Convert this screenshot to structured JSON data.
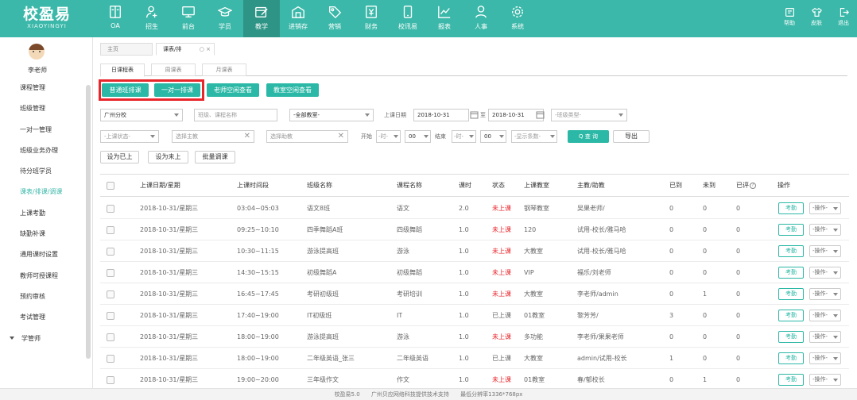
{
  "brand": {
    "name": "校盈易",
    "sub": "XIAOYINGYI"
  },
  "nav": [
    {
      "label": "OA",
      "icon": "oa-icon"
    },
    {
      "label": "招生",
      "icon": "enroll-icon"
    },
    {
      "label": "前台",
      "icon": "frontdesk-icon"
    },
    {
      "label": "学员",
      "icon": "student-icon"
    },
    {
      "label": "教学",
      "icon": "teaching-icon",
      "active": true
    },
    {
      "label": "进销存",
      "icon": "inventory-icon"
    },
    {
      "label": "营销",
      "icon": "marketing-icon"
    },
    {
      "label": "财务",
      "icon": "finance-icon"
    },
    {
      "label": "校讯易",
      "icon": "mobile-icon"
    },
    {
      "label": "报表",
      "icon": "report-icon"
    },
    {
      "label": "人事",
      "icon": "hr-icon"
    },
    {
      "label": "系统",
      "icon": "system-icon"
    }
  ],
  "tools": [
    {
      "label": "帮助",
      "icon": "help-icon"
    },
    {
      "label": "皮肤",
      "icon": "skin-icon"
    },
    {
      "label": "退出",
      "icon": "logout-icon"
    }
  ],
  "user": {
    "name": "李老师"
  },
  "sidebar": {
    "items": [
      "课程管理",
      "班级管理",
      "一对一管理",
      "班级业务办理",
      "待分班学员",
      "课表/排课/调课",
      "上课考勤",
      "缺勤补课",
      "通用课时设置",
      "教师可授课程",
      "预约审核",
      "考试管理"
    ],
    "active_index": 5,
    "group": "学管师"
  },
  "page_tabs": [
    {
      "label": "主页"
    },
    {
      "label": "课表/排",
      "controls": "○ ×"
    }
  ],
  "sub_tabs": [
    "日课程表",
    "周课表",
    "月课表"
  ],
  "actions": [
    "普通班排课",
    "一对一排课",
    "老师空闲查看",
    "教室空闲查看"
  ],
  "filters": {
    "campus": "广州分校",
    "class_search": "班级、课程名称",
    "classroom": "-全部教室-",
    "date_label": "上课日期",
    "date_from": "2018-10-31",
    "date_to_label": "至",
    "date_to": "2018-10-31",
    "class_type": "-班级类型-",
    "status": "-上课状态-",
    "main_teacher": "选择主教",
    "assistant": "选择助教",
    "start_label": "开始",
    "start_hour": "-时-",
    "start_min": "00",
    "end_label": "结束",
    "end_hour": "-时-",
    "end_min": "00",
    "page_size": "-显示条数-",
    "query": "Q 查 询",
    "export": "导出"
  },
  "bulk": [
    "设为已上",
    "设为未上",
    "批量调课"
  ],
  "table": {
    "headers": [
      "上课日期/星期",
      "上课时间段",
      "班级名称",
      "课程名称",
      "课时",
      "状态",
      "上课教室",
      "主教/助教",
      "已到",
      "未到",
      "已评",
      "操作"
    ],
    "attendance_label": "考勤",
    "op_label": "-操作-",
    "rows": [
      [
        "2018-10-31/星期三",
        "03:04~05:03",
        "语文8班",
        "语文",
        "2.0",
        "未上课",
        "钢琴教室",
        "吴果老师/",
        "0",
        "0",
        "0"
      ],
      [
        "2018-10-31/星期三",
        "09:25~10:10",
        "四季舞蹈A班",
        "四级舞蹈",
        "1.0",
        "未上课",
        "120",
        "试用-校长/雅马哈",
        "0",
        "0",
        "0"
      ],
      [
        "2018-10-31/星期三",
        "10:30~11:15",
        "游泳提高班",
        "游泳",
        "1.0",
        "未上课",
        "大教室",
        "试用-校长/雅马哈",
        "0",
        "0",
        "0"
      ],
      [
        "2018-10-31/星期三",
        "14:30~15:15",
        "初级舞蹈A",
        "初级舞蹈",
        "1.0",
        "未上课",
        "VIP",
        "福乐/刘老师",
        "0",
        "0",
        "0"
      ],
      [
        "2018-10-31/星期三",
        "16:45~17:45",
        "考研初级班",
        "考研培训",
        "1.0",
        "未上课",
        "大教室",
        "李老师/admin",
        "0",
        "1",
        "0"
      ],
      [
        "2018-10-31/星期三",
        "17:40~19:00",
        "IT初级班",
        "IT",
        "1.0",
        "已上课",
        "01教室",
        "黎芳芳/",
        "3",
        "0",
        "0"
      ],
      [
        "2018-10-31/星期三",
        "18:00~19:00",
        "游泳提高班",
        "游泳",
        "1.0",
        "未上课",
        "多功能",
        "李老师/果果老师",
        "0",
        "0",
        "0"
      ],
      [
        "2018-10-31/星期三",
        "18:00~19:00",
        "二年级英语_张三",
        "二年级英语",
        "1.0",
        "已上课",
        "大教室",
        "admin/试用-校长",
        "1",
        "0",
        "0"
      ],
      [
        "2018-10-31/星期三",
        "19:00~20:00",
        "三年级作文",
        "作文",
        "1.0",
        "未上课",
        "01教室",
        "春/郁校长",
        "0",
        "1",
        "0"
      ]
    ]
  },
  "footer": {
    "version": "校盈易5.0",
    "support": "广州贝应网络科技提供技术支持",
    "resolution": "最低分辨率1336*768px"
  },
  "colors": {
    "primary": "#3bb8a9",
    "button": "#2cb8a6",
    "highlight": "#e8262c"
  }
}
